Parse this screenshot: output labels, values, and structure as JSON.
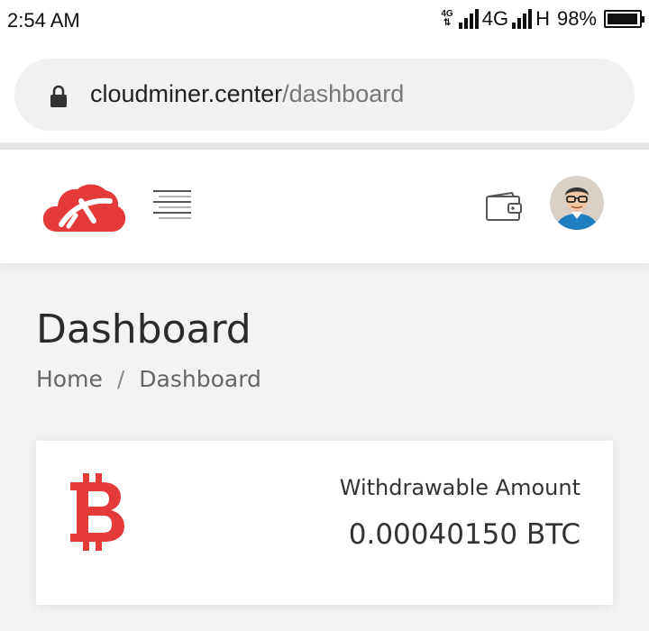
{
  "status_bar": {
    "time": "2:54 AM",
    "network1_top": "4G",
    "network2": "4G",
    "network3": "H",
    "battery": "98%",
    "battery_level": 0.98
  },
  "browser": {
    "url_domain": "cloudminer.center",
    "url_path": "/dashboard"
  },
  "header": {
    "logo_icon": "cloud-pickaxe-logo",
    "menu_icon": "hamburger-icon",
    "wallet_icon": "wallet-icon",
    "avatar_icon": "avatar"
  },
  "page": {
    "title": "Dashboard",
    "breadcrumb": {
      "home": "Home",
      "separator": "/",
      "current": "Dashboard"
    }
  },
  "card": {
    "icon": "bitcoin-icon",
    "label": "Withdrawable Amount",
    "value": "0.00040150 BTC"
  },
  "colors": {
    "brand_red": "#e43a3a",
    "background": "#f3f3f3"
  }
}
